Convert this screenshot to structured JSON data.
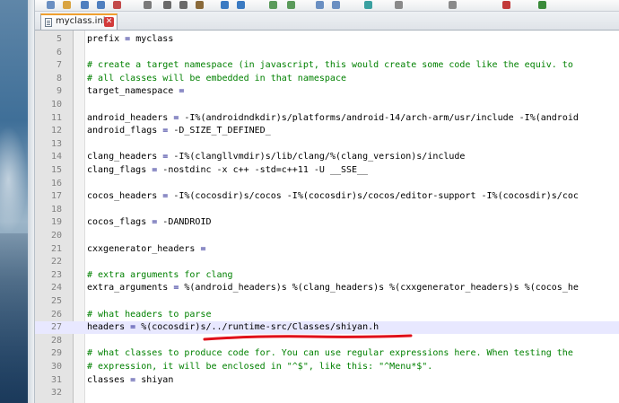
{
  "editor": {
    "tab_label": "myclass.ini",
    "close_glyph": "✕",
    "lines": [
      {
        "n": "5",
        "parts": [
          {
            "t": "prefix "
          },
          {
            "t": "=",
            "op": true
          },
          {
            "t": " myclass"
          }
        ]
      },
      {
        "n": "6",
        "parts": []
      },
      {
        "n": "7",
        "comment": true,
        "parts": [
          {
            "t": "# create a target namespace (in javascript, this would create some code like the equiv. to"
          }
        ]
      },
      {
        "n": "8",
        "comment": true,
        "parts": [
          {
            "t": "# all classes will be embedded in that namespace"
          }
        ]
      },
      {
        "n": "9",
        "parts": [
          {
            "t": "target_namespace "
          },
          {
            "t": "=",
            "op": true
          }
        ]
      },
      {
        "n": "10",
        "parts": []
      },
      {
        "n": "11",
        "parts": [
          {
            "t": "android_headers "
          },
          {
            "t": "=",
            "op": true
          },
          {
            "t": " -I%(androidndkdir)s/platforms/android-14/arch-arm/usr/include -I%(android"
          }
        ]
      },
      {
        "n": "12",
        "parts": [
          {
            "t": "android_flags "
          },
          {
            "t": "=",
            "op": true
          },
          {
            "t": " -D_SIZE_T_DEFINED_"
          }
        ]
      },
      {
        "n": "13",
        "parts": []
      },
      {
        "n": "14",
        "parts": [
          {
            "t": "clang_headers "
          },
          {
            "t": "=",
            "op": true
          },
          {
            "t": " -I%(clangllvmdir)s/lib/clang/%(clang_version)s/include"
          }
        ]
      },
      {
        "n": "15",
        "parts": [
          {
            "t": "clang_flags "
          },
          {
            "t": "=",
            "op": true
          },
          {
            "t": " -nostdinc -x c++ -std=c++11 -U __SSE__"
          }
        ]
      },
      {
        "n": "16",
        "parts": []
      },
      {
        "n": "17",
        "parts": [
          {
            "t": "cocos_headers "
          },
          {
            "t": "=",
            "op": true
          },
          {
            "t": " -I%(cocosdir)s/cocos -I%(cocosdir)s/cocos/editor-support -I%(cocosdir)s/coc"
          }
        ]
      },
      {
        "n": "18",
        "parts": []
      },
      {
        "n": "19",
        "parts": [
          {
            "t": "cocos_flags "
          },
          {
            "t": "=",
            "op": true
          },
          {
            "t": " -DANDROID"
          }
        ]
      },
      {
        "n": "20",
        "parts": []
      },
      {
        "n": "21",
        "parts": [
          {
            "t": "cxxgenerator_headers "
          },
          {
            "t": "=",
            "op": true
          }
        ]
      },
      {
        "n": "22",
        "parts": []
      },
      {
        "n": "23",
        "comment": true,
        "parts": [
          {
            "t": "# extra arguments for clang"
          }
        ]
      },
      {
        "n": "24",
        "parts": [
          {
            "t": "extra_arguments "
          },
          {
            "t": "=",
            "op": true
          },
          {
            "t": " %(android_headers)s %(clang_headers)s %(cxxgenerator_headers)s %(cocos_he"
          }
        ]
      },
      {
        "n": "25",
        "parts": []
      },
      {
        "n": "26",
        "comment": true,
        "parts": [
          {
            "t": "# what headers to parse"
          }
        ]
      },
      {
        "n": "27",
        "current": true,
        "parts": [
          {
            "t": "headers "
          },
          {
            "t": "=",
            "op": true
          },
          {
            "t": " %(cocosdir)s/../runtime-src/Classes/shiyan.h"
          }
        ]
      },
      {
        "n": "28",
        "parts": []
      },
      {
        "n": "29",
        "comment": true,
        "parts": [
          {
            "t": "# what classes to produce code for. You can use regular expressions here. When testing the"
          }
        ]
      },
      {
        "n": "30",
        "comment": true,
        "parts": [
          {
            "t": "# expression, it will be enclosed in \"^$\", like this: \"^Menu*$\"."
          }
        ]
      },
      {
        "n": "31",
        "parts": [
          {
            "t": "classes "
          },
          {
            "t": "=",
            "op": true
          },
          {
            "t": " shiyan"
          }
        ]
      },
      {
        "n": "32",
        "parts": []
      }
    ]
  },
  "colors": {
    "comment": "#008000",
    "operator": "#000080",
    "current_line": "#e8e8ff",
    "annotation": "#e0101a",
    "tab_accent": "#f0a030"
  },
  "toolbar_icons": [
    "new-file-icon",
    "open-icon",
    "save-icon",
    "save-all-icon",
    "close-icon",
    "print-icon",
    "cut-icon",
    "copy-icon",
    "paste-icon",
    "undo-icon",
    "redo-icon",
    "find-icon",
    "replace-icon",
    "zoom-in-icon",
    "zoom-out-icon",
    "sync-icon",
    "wrap-icon",
    "indent-guide-icon",
    "macro-record-icon",
    "macro-play-icon"
  ]
}
